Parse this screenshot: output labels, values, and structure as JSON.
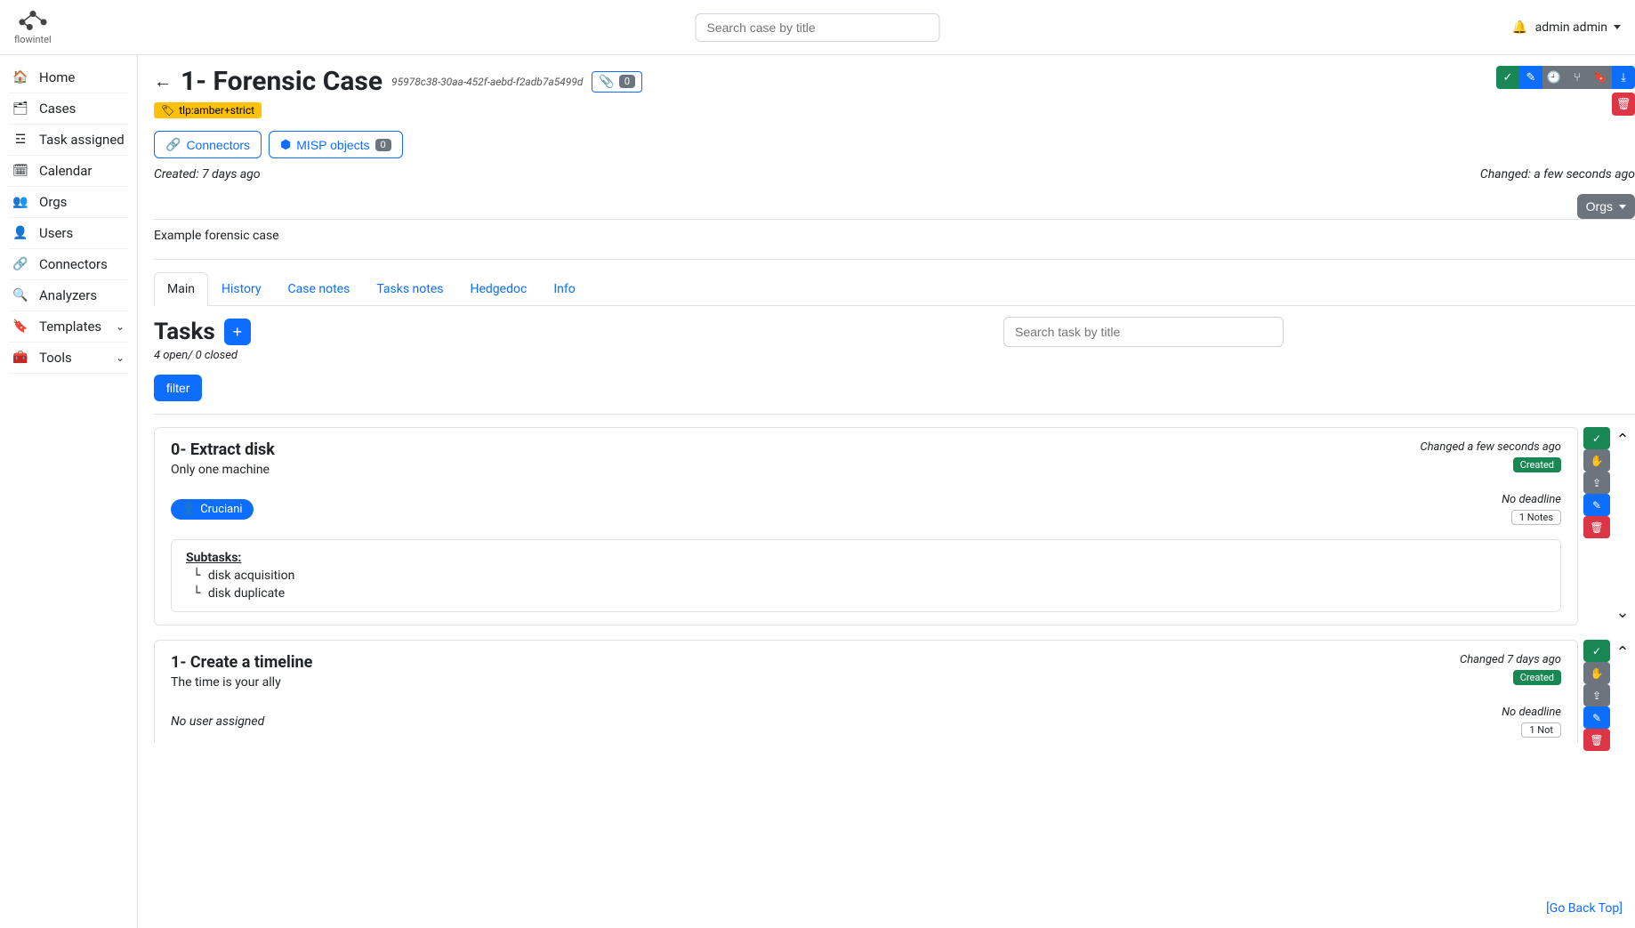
{
  "brand": "flowintel",
  "search": {
    "placeholder": "Search case by title"
  },
  "user": {
    "name": "admin admin"
  },
  "sidebar": {
    "items": [
      {
        "label": "Home",
        "icon": "🏠"
      },
      {
        "label": "Cases",
        "icon": "🗂"
      },
      {
        "label": "Task assigned",
        "icon": "☲"
      },
      {
        "label": "Calendar",
        "icon": "🗓"
      },
      {
        "label": "Orgs",
        "icon": "👥"
      },
      {
        "label": "Users",
        "icon": "👤"
      },
      {
        "label": "Connectors",
        "icon": "🔗"
      },
      {
        "label": "Analyzers",
        "icon": "🔍"
      },
      {
        "label": "Templates",
        "icon": "🔖",
        "expandable": true
      },
      {
        "label": "Tools",
        "icon": "🧰",
        "expandable": true
      }
    ]
  },
  "case": {
    "title": "1- Forensic Case",
    "uuid": "95978c38-30aa-452f-aebd-f2adb7a5499d",
    "attachment_count": "0",
    "tlp": "tlp:amber+strict",
    "connectors_label": "Connectors",
    "misp_label": "MISP objects",
    "misp_count": "0",
    "created": "Created: 7 days ago",
    "changed": "Changed: a few seconds ago",
    "description": "Example forensic case",
    "orgs_btn": "Orgs"
  },
  "tabs": [
    "Main",
    "History",
    "Case notes",
    "Tasks notes",
    "Hedgedoc",
    "Info"
  ],
  "tasks_section": {
    "title": "Tasks",
    "search_placeholder": "Search task by title",
    "count_text": "4 open/ 0 closed",
    "filter_label": "filter"
  },
  "tasks": [
    {
      "title": "0- Extract disk",
      "desc": "Only one machine",
      "changed": "Changed a few seconds ago",
      "status": "Created",
      "assignee": "Cruciani",
      "deadline": "No deadline",
      "notes": "1 Notes",
      "subtasks_label": "Subtasks:",
      "subtasks": [
        "disk acquisition",
        "disk duplicate"
      ]
    },
    {
      "title": "1- Create a timeline",
      "desc": "The time is your ally",
      "changed": "Changed 7 days ago",
      "status": "Created",
      "no_assignee": "No user assigned",
      "deadline": "No deadline",
      "notes": "1 Not"
    }
  ],
  "go_back_top": "Go Back Top"
}
